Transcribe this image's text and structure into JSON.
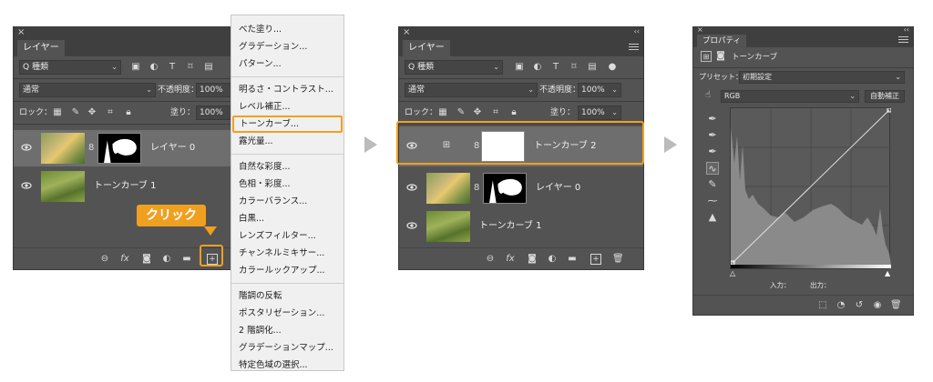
{
  "layers_panel_1": {
    "tab": "レイヤー",
    "filter_label": "Q 種類",
    "blend_mode": "通常",
    "opacity_label": "不透明度：",
    "opacity_value": "100%",
    "lock_label": "ロック：",
    "fill_label": "塗り：",
    "fill_value": "100%",
    "layers": [
      {
        "name": "レイヤー 0"
      },
      {
        "name": "トーンカーブ 1"
      }
    ],
    "callout": "クリック"
  },
  "menu": {
    "items": [
      "べた塗り...",
      "グラデーション...",
      "パターン...",
      "---",
      "明るさ・コントラスト...",
      "レベル補正...",
      "トーンカーブ...",
      "露光量...",
      "---",
      "自然な彩度...",
      "色相・彩度...",
      "カラーバランス...",
      "白黒...",
      "レンズフィルター...",
      "チャンネルミキサー...",
      "カラールックアップ...",
      "---",
      "階調の反転",
      "ポスタリゼーション...",
      "2 階調化...",
      "グラデーションマップ...",
      "特定色域の選択..."
    ],
    "highlighted": "トーンカーブ..."
  },
  "layers_panel_2": {
    "tab": "レイヤー",
    "filter_label": "Q 種類",
    "blend_mode": "通常",
    "opacity_label": "不透明度：",
    "opacity_value": "100%",
    "lock_label": "ロック：",
    "fill_label": "塗り：",
    "fill_value": "100%",
    "layers": [
      {
        "name": "トーンカーブ 2"
      },
      {
        "name": "レイヤー 0"
      },
      {
        "name": "トーンカーブ 1"
      }
    ]
  },
  "properties_panel": {
    "tab": "プロパティ",
    "header": "トーンカーブ",
    "preset_label": "プリセット：",
    "preset_value": "初期設定",
    "channel": "RGB",
    "auto_button": "自動補正",
    "input_label": "入力：",
    "output_label": "出力："
  },
  "colors": {
    "accent": "#f0a020",
    "panel_bg": "#535353"
  }
}
